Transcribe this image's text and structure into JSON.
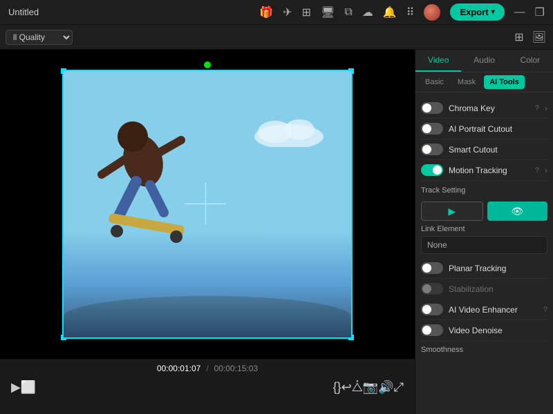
{
  "titlebar": {
    "title": "Untitled",
    "export_label": "Export",
    "win_minimize": "—",
    "win_maximize": "❐"
  },
  "toolbar": {
    "quality": "ll Quality",
    "quality_dropdown": "▾"
  },
  "timeline": {
    "current_time": "00:00:01:07",
    "separator": "/",
    "total_time": "00:00:15:03"
  },
  "panel": {
    "tabs": [
      "Video",
      "Audio",
      "Color"
    ],
    "active_tab": "Video",
    "sub_tabs": [
      "Basic",
      "Mask",
      "AI Tools"
    ],
    "active_sub": "AI Tools"
  },
  "ai_tools": {
    "chroma_key": {
      "label": "Chroma Key",
      "enabled": false
    },
    "ai_portrait": {
      "label": "AI Portrait Cutout",
      "enabled": false
    },
    "smart_cutout": {
      "label": "Smart Cutout",
      "enabled": false
    },
    "motion_tracking": {
      "label": "Motion Tracking",
      "enabled": true
    },
    "track_setting_label": "Track Setting",
    "link_element_label": "Link Element",
    "link_element_value": "None",
    "planar_tracking": {
      "label": "Planar Tracking",
      "enabled": false
    },
    "stabilization": {
      "label": "Stabilization",
      "enabled": false
    },
    "ai_video_enhancer": {
      "label": "AI Video Enhancer",
      "enabled": false
    },
    "video_denoise": {
      "label": "Video Denoise",
      "enabled": false
    },
    "smoothness_label": "Smoothness"
  }
}
